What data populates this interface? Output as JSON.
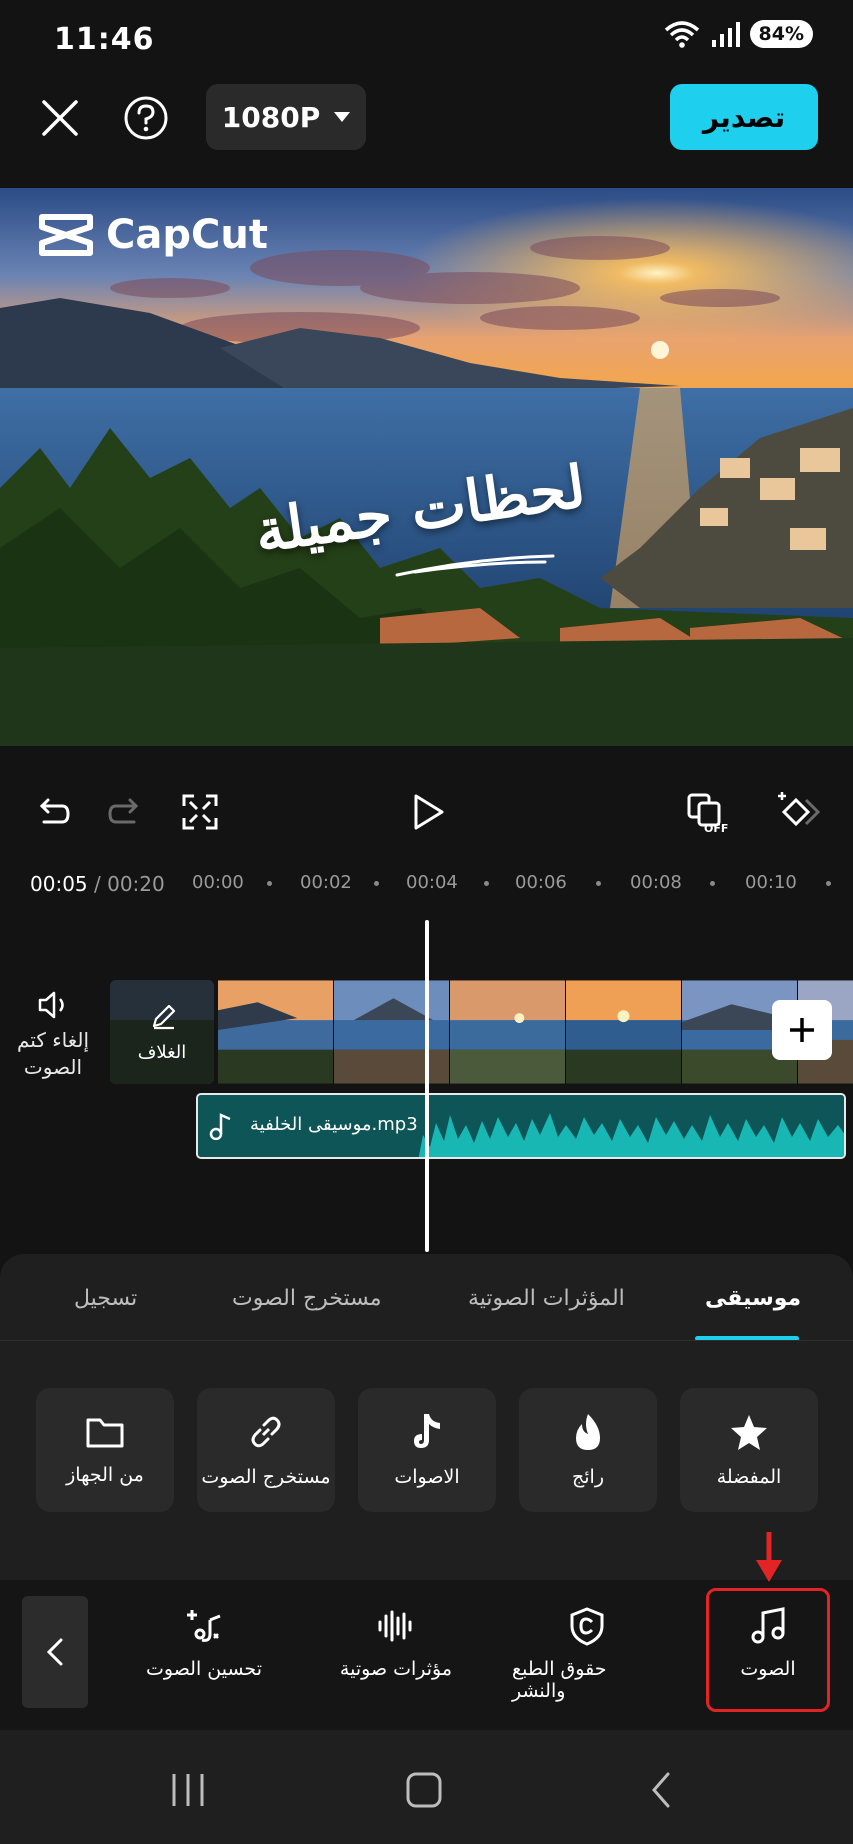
{
  "status_bar": {
    "time": "11:46",
    "battery": "84%"
  },
  "top_bar": {
    "close_icon": "close-icon",
    "help_icon": "help-icon",
    "resolution": "1080P",
    "export_label": "تصدير",
    "accent_color": "#1ed0ee"
  },
  "preview": {
    "brand": "CapCut",
    "overlay_text": "لحظات جميلة"
  },
  "controls": {
    "current_time": "00:05",
    "total_time": "/ 00:20",
    "ruler": [
      "00:00",
      "00:02",
      "00:04",
      "00:06",
      "00:08",
      "00:10"
    ],
    "effects_toggle": "OFF"
  },
  "timeline": {
    "mute_label": "إلغاء كتم الصوت",
    "cover_label": "الغلاف",
    "audio_track_label": "موسيقى الخلفية.mp3"
  },
  "tabs": [
    {
      "label": "موسيقى",
      "active": true
    },
    {
      "label": "المؤثرات الصوتية",
      "active": false
    },
    {
      "label": "مستخرج الصوت",
      "active": false
    },
    {
      "label": "تسجيل",
      "active": false
    }
  ],
  "tiles": [
    {
      "label": "المفضلة",
      "icon": "star-icon"
    },
    {
      "label": "رائج",
      "icon": "flame-icon"
    },
    {
      "label": "الاصوات",
      "icon": "tiktok-icon"
    },
    {
      "label": "مستخرج الصوت",
      "icon": "link-icon"
    },
    {
      "label": "من الجهاز",
      "icon": "folder-icon"
    }
  ],
  "toolbar": {
    "items": [
      {
        "label": "الصوت",
        "icon": "music-note-icon"
      },
      {
        "label": "حقوق الطبع والنشر",
        "icon": "copyright-icon"
      },
      {
        "label": "مؤثرات صوتية",
        "icon": "waveform-icon"
      },
      {
        "label": "تحسين الصوت",
        "icon": "magic-wand-icon"
      }
    ],
    "highlight_color": "#e32424"
  }
}
